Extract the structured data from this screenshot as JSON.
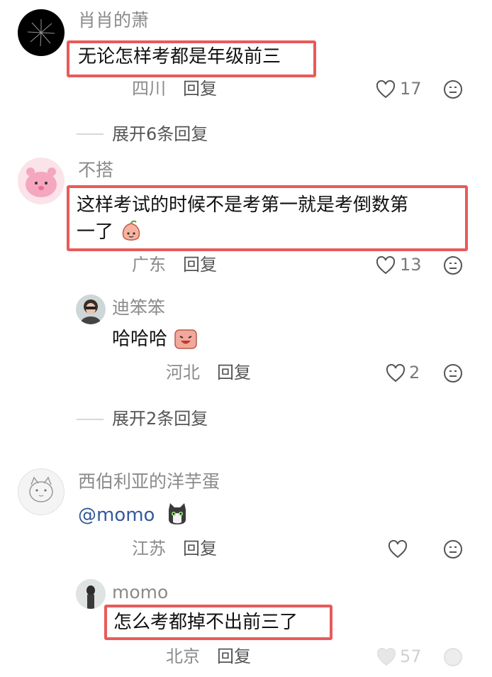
{
  "comments": [
    {
      "author": "肖肖的萧",
      "text": "无论怎样考都是年级前三",
      "location": "四川",
      "reply_label": "回复",
      "likes": "17",
      "expand_label": "展开6条回复"
    },
    {
      "author": "不搭",
      "text_line1": "这样考试的时候不是考第一就是考倒数第",
      "text_line2": "一了",
      "location": "广东",
      "reply_label": "回复",
      "likes": "13"
    },
    {
      "author": "迪笨笨",
      "text": "哈哈哈",
      "location": "河北",
      "reply_label": "回复",
      "likes": "2",
      "expand_label": "展开2条回复"
    },
    {
      "author": "西伯利亚的洋芋蛋",
      "text": "@momo",
      "location": "江苏",
      "reply_label": "回复",
      "likes": ""
    },
    {
      "author": "momo",
      "text": "怎么考都掉不出前三了",
      "location": "北京",
      "reply_label": "回复",
      "likes": "57"
    }
  ],
  "colors": {
    "highlight_box": "#e85a5a",
    "meta_gray": "#8a8a8a",
    "mention_blue": "#345a9a"
  }
}
